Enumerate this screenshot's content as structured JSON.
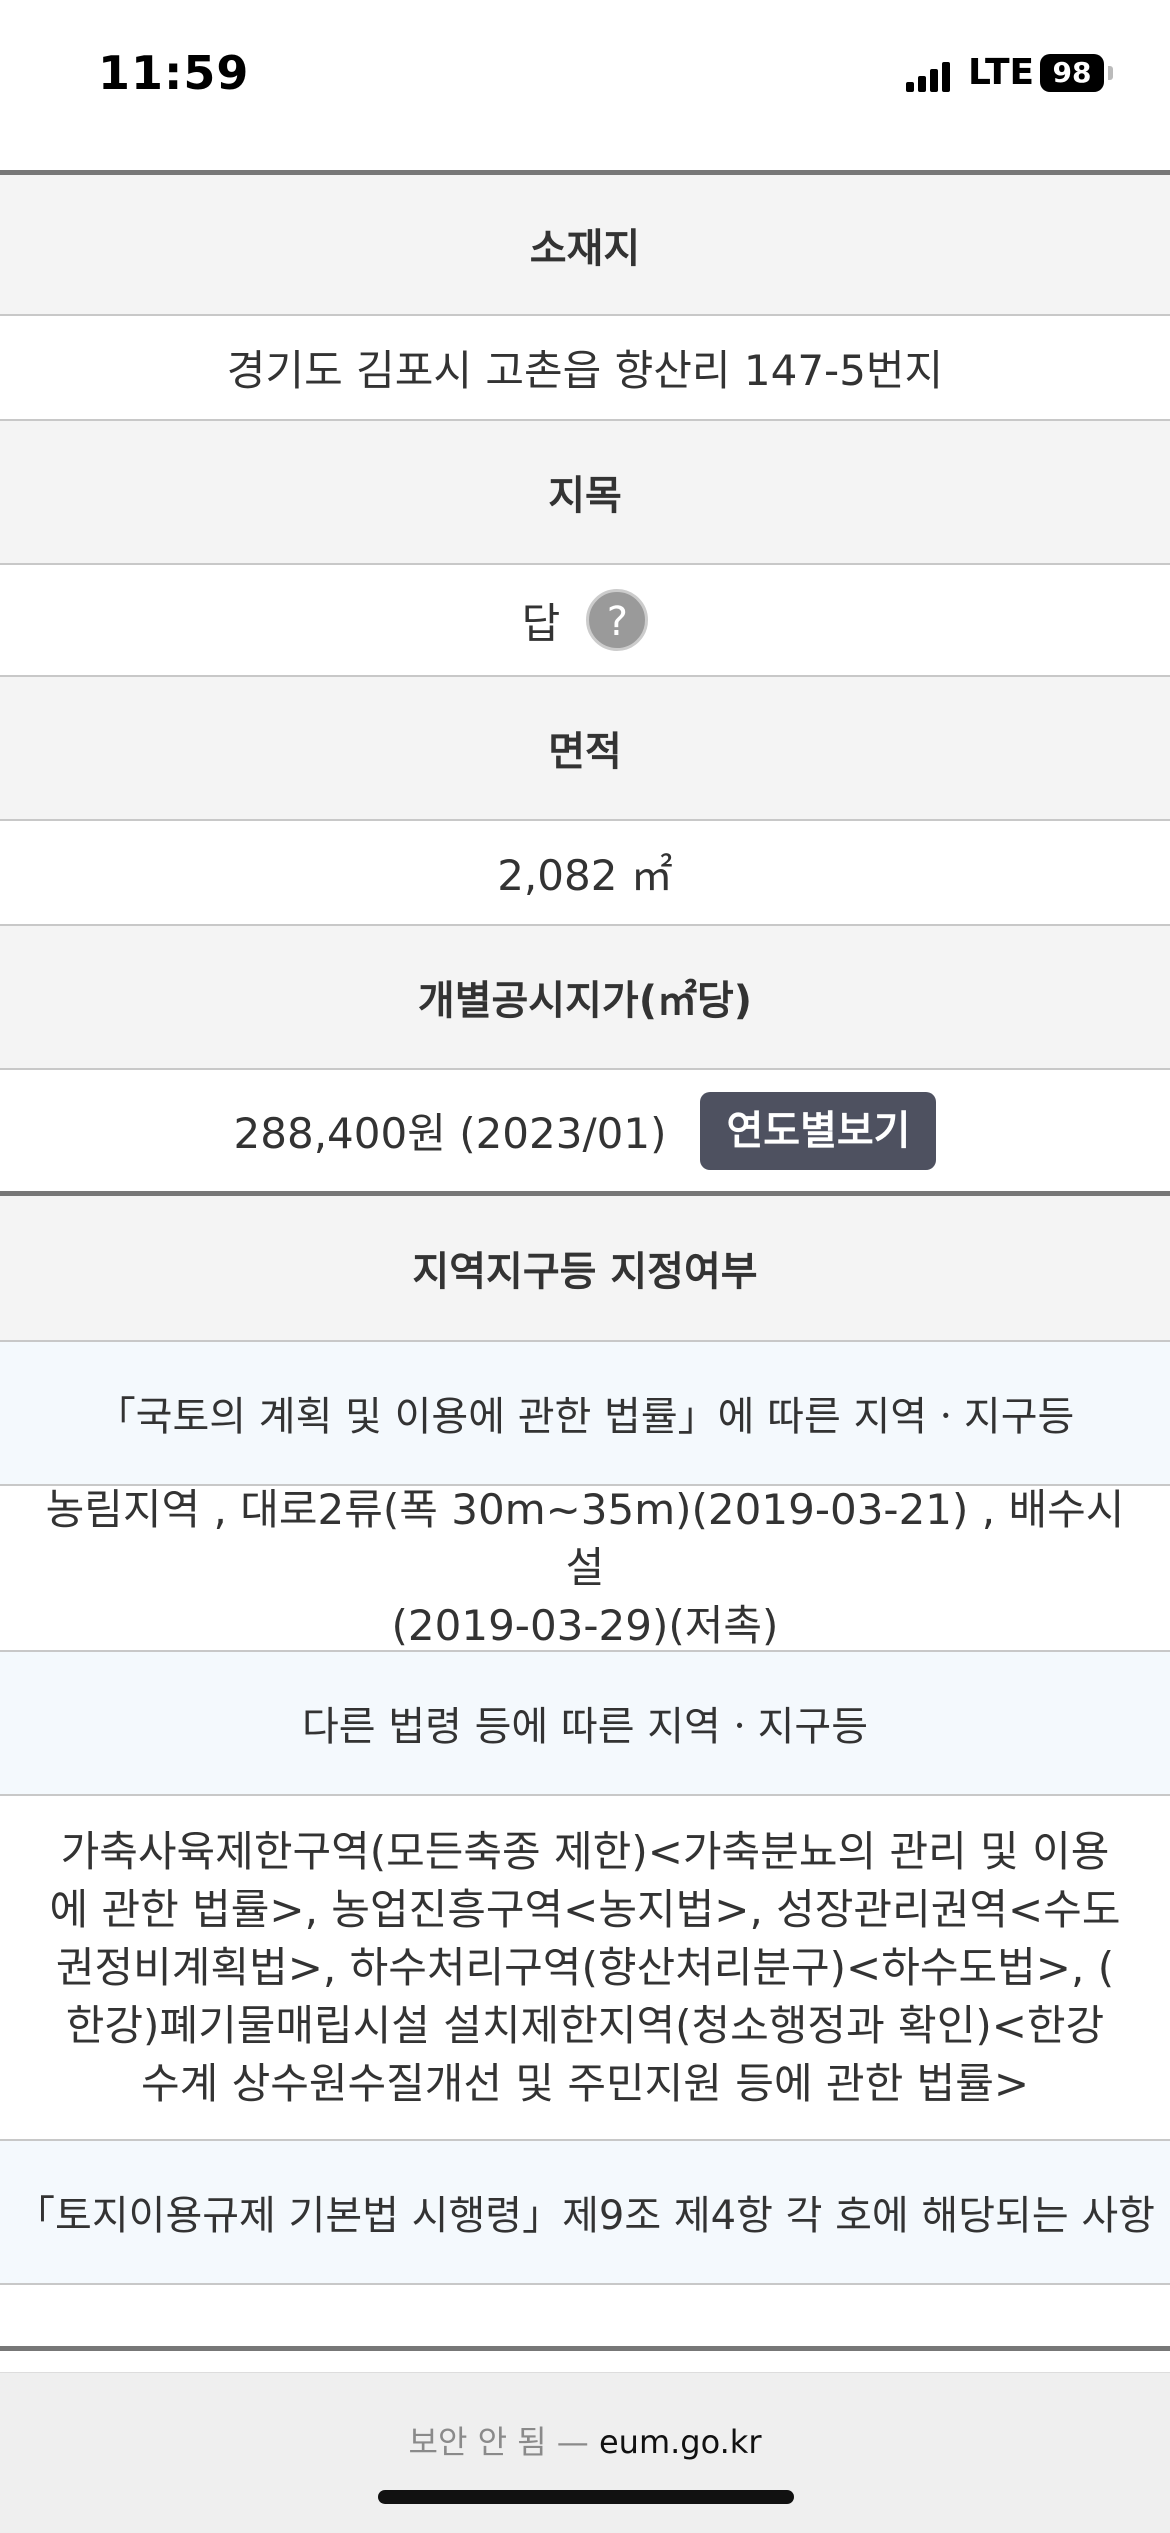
{
  "status_bar": {
    "time": "11:59",
    "network": "LTE",
    "battery": "98"
  },
  "location": {
    "label": "소재지",
    "value": "경기도 김포시 고촌읍 향산리 147-5번지"
  },
  "land_category": {
    "label": "지목",
    "value": "답",
    "help_symbol": "?"
  },
  "area": {
    "label": "면적",
    "value": "2,082 ㎡"
  },
  "price": {
    "label": "개별공시지가(㎡당)",
    "value": "288,400원 (2023/01)",
    "button": "연도별보기"
  },
  "zoning": {
    "label": "지역지구등 지정여부",
    "section1_title": "「국토의 계획 및 이용에 관한 법률」에 따른 지역ㆍ지구등",
    "section1_line1": "농림지역 , 대로2류(폭 30m~35m)(2019-03-21) , 배수시설",
    "section1_line2": "(2019-03-29)(저촉)",
    "section2_title": "다른 법령 등에 따른 지역ㆍ지구등",
    "section2_line1": "가축사육제한구역(모든축종 제한)<가축분뇨의 관리 및 이용",
    "section2_line2": "에 관한 법률>, 농업진흥구역<농지법>, 성장관리권역<수도",
    "section2_line3": "권정비계획법>, 하수처리구역(향산처리분구)<하수도법>, (",
    "section2_line4": "한강)폐기물매립시설 설치제한지역(청소행정과 확인)<한강",
    "section2_line5": "수계 상수원수질개선 및 주민지원 등에 관한 법률>",
    "section3_title": "「토지이용규제 기본법 시행령」제9조 제4항 각 호에 해당되는 사항"
  },
  "browser": {
    "security_warning": "보안 안 됨 —",
    "domain": "eum.go.kr"
  }
}
